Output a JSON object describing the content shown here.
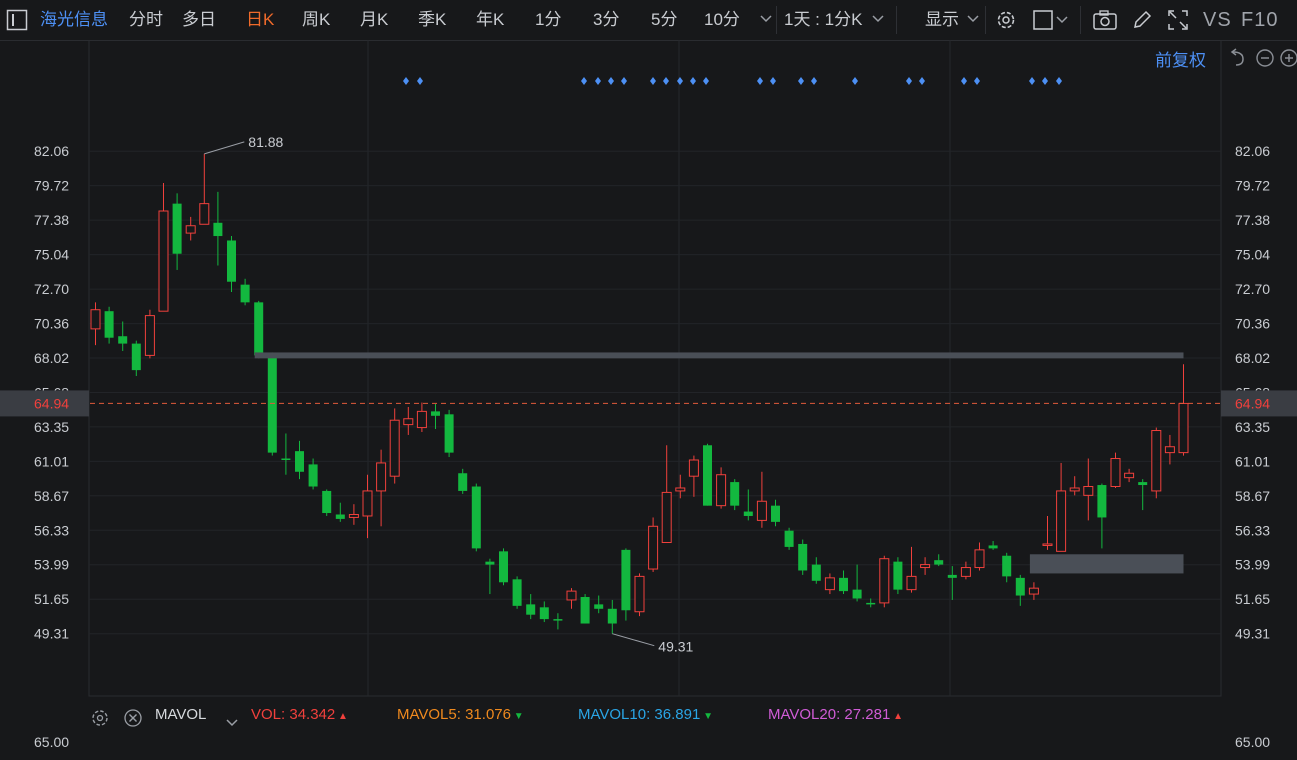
{
  "toolbar": {
    "stock_name": "海光信息",
    "periods": [
      "分时",
      "多日",
      "日K",
      "周K",
      "月K",
      "季K",
      "年K",
      "1分",
      "3分",
      "5分",
      "10分"
    ],
    "active_period": "日K",
    "combo": "1天 : 1分K",
    "display": "显示",
    "vs": "VS",
    "f10": "F10",
    "adjust": "前复权"
  },
  "chart_data": {
    "type": "candlestick",
    "y_ticks": [
      "82.06",
      "79.72",
      "77.38",
      "75.04",
      "72.70",
      "70.36",
      "68.02",
      "65.68",
      "63.35",
      "61.01",
      "58.67",
      "56.33",
      "53.99",
      "51.65",
      "49.31"
    ],
    "ylim": [
      47.66,
      84.72
    ],
    "current_price": "64.94",
    "max_label": "81.88",
    "min_label": "49.31",
    "up_color": "#f0403c",
    "down_color": "#13b83f",
    "candles": [
      {
        "o": 70.0,
        "h": 71.8,
        "l": 68.9,
        "c": 71.3
      },
      {
        "o": 71.2,
        "h": 71.5,
        "l": 69.0,
        "c": 69.4
      },
      {
        "o": 69.5,
        "h": 70.5,
        "l": 68.5,
        "c": 69.0
      },
      {
        "o": 69.0,
        "h": 69.2,
        "l": 66.8,
        "c": 67.2
      },
      {
        "o": 68.2,
        "h": 71.3,
        "l": 68.0,
        "c": 70.9
      },
      {
        "o": 71.2,
        "h": 79.9,
        "l": 71.2,
        "c": 78.0
      },
      {
        "o": 78.5,
        "h": 79.2,
        "l": 74.0,
        "c": 75.1
      },
      {
        "o": 76.5,
        "h": 77.6,
        "l": 76.0,
        "c": 77.0
      },
      {
        "o": 77.1,
        "h": 81.88,
        "l": 77.1,
        "c": 78.5
      },
      {
        "o": 77.2,
        "h": 79.3,
        "l": 74.3,
        "c": 76.3
      },
      {
        "o": 76.0,
        "h": 76.3,
        "l": 72.5,
        "c": 73.2
      },
      {
        "o": 73.0,
        "h": 73.4,
        "l": 71.6,
        "c": 71.8
      },
      {
        "o": 71.8,
        "h": 71.9,
        "l": 68.0,
        "c": 68.2
      },
      {
        "o": 68.2,
        "h": 68.4,
        "l": 61.4,
        "c": 61.6
      },
      {
        "o": 61.2,
        "h": 62.9,
        "l": 60.1,
        "c": 61.1
      },
      {
        "o": 61.7,
        "h": 62.4,
        "l": 59.8,
        "c": 60.3
      },
      {
        "o": 60.8,
        "h": 61.2,
        "l": 59.1,
        "c": 59.3
      },
      {
        "o": 59.0,
        "h": 59.1,
        "l": 57.3,
        "c": 57.5
      },
      {
        "o": 57.4,
        "h": 58.2,
        "l": 56.9,
        "c": 57.1
      },
      {
        "o": 57.2,
        "h": 58.1,
        "l": 56.7,
        "c": 57.4
      },
      {
        "o": 57.3,
        "h": 60.1,
        "l": 55.8,
        "c": 59.0
      },
      {
        "o": 59.0,
        "h": 61.8,
        "l": 56.6,
        "c": 60.9
      },
      {
        "o": 60.0,
        "h": 64.6,
        "l": 59.5,
        "c": 63.8
      },
      {
        "o": 63.5,
        "h": 64.7,
        "l": 62.8,
        "c": 63.9
      },
      {
        "o": 63.3,
        "h": 65.0,
        "l": 63.0,
        "c": 64.4
      },
      {
        "o": 64.4,
        "h": 64.9,
        "l": 63.2,
        "c": 64.1
      },
      {
        "o": 64.2,
        "h": 64.5,
        "l": 61.3,
        "c": 61.6
      },
      {
        "o": 60.2,
        "h": 60.5,
        "l": 58.8,
        "c": 59.0
      },
      {
        "o": 59.3,
        "h": 59.5,
        "l": 54.9,
        "c": 55.1
      },
      {
        "o": 54.2,
        "h": 54.4,
        "l": 52.0,
        "c": 54.0
      },
      {
        "o": 54.9,
        "h": 55.1,
        "l": 52.6,
        "c": 52.8
      },
      {
        "o": 53.0,
        "h": 53.2,
        "l": 51.0,
        "c": 51.2
      },
      {
        "o": 51.3,
        "h": 52.0,
        "l": 50.3,
        "c": 50.6
      },
      {
        "o": 51.1,
        "h": 51.5,
        "l": 50.1,
        "c": 50.3
      },
      {
        "o": 50.3,
        "h": 50.7,
        "l": 49.6,
        "c": 50.2
      },
      {
        "o": 51.6,
        "h": 52.4,
        "l": 51.0,
        "c": 52.2
      },
      {
        "o": 51.8,
        "h": 52.0,
        "l": 50.0,
        "c": 50.0
      },
      {
        "o": 51.3,
        "h": 51.9,
        "l": 50.7,
        "c": 51.0
      },
      {
        "o": 51.0,
        "h": 51.6,
        "l": 49.31,
        "c": 50.0
      },
      {
        "o": 55.0,
        "h": 55.1,
        "l": 50.2,
        "c": 50.9
      },
      {
        "o": 50.8,
        "h": 53.4,
        "l": 50.5,
        "c": 53.2
      },
      {
        "o": 53.7,
        "h": 57.2,
        "l": 53.5,
        "c": 56.6
      },
      {
        "o": 55.5,
        "h": 62.1,
        "l": 55.5,
        "c": 58.9
      },
      {
        "o": 59.0,
        "h": 60.1,
        "l": 58.5,
        "c": 59.2
      },
      {
        "o": 60.0,
        "h": 61.4,
        "l": 58.6,
        "c": 61.1
      },
      {
        "o": 62.1,
        "h": 62.2,
        "l": 58.0,
        "c": 58.0
      },
      {
        "o": 58.0,
        "h": 60.6,
        "l": 57.8,
        "c": 60.1
      },
      {
        "o": 59.6,
        "h": 59.8,
        "l": 57.7,
        "c": 58.0
      },
      {
        "o": 57.6,
        "h": 59.1,
        "l": 57.0,
        "c": 57.3
      },
      {
        "o": 57.0,
        "h": 60.3,
        "l": 56.5,
        "c": 58.3
      },
      {
        "o": 58.0,
        "h": 58.4,
        "l": 56.6,
        "c": 56.9
      },
      {
        "o": 56.3,
        "h": 56.5,
        "l": 55.0,
        "c": 55.2
      },
      {
        "o": 55.4,
        "h": 55.7,
        "l": 53.3,
        "c": 53.6
      },
      {
        "o": 54.0,
        "h": 54.5,
        "l": 52.7,
        "c": 52.9
      },
      {
        "o": 52.3,
        "h": 53.4,
        "l": 52.0,
        "c": 53.1
      },
      {
        "o": 53.1,
        "h": 53.6,
        "l": 52.0,
        "c": 52.2
      },
      {
        "o": 52.3,
        "h": 54.0,
        "l": 51.5,
        "c": 51.7
      },
      {
        "o": 51.4,
        "h": 51.7,
        "l": 51.1,
        "c": 51.3
      },
      {
        "o": 51.4,
        "h": 54.6,
        "l": 51.1,
        "c": 54.4
      },
      {
        "o": 54.2,
        "h": 54.5,
        "l": 52.0,
        "c": 52.3
      },
      {
        "o": 52.3,
        "h": 55.2,
        "l": 52.1,
        "c": 53.2
      },
      {
        "o": 53.8,
        "h": 54.5,
        "l": 53.3,
        "c": 54.0
      },
      {
        "o": 54.3,
        "h": 54.7,
        "l": 53.9,
        "c": 54.0
      },
      {
        "o": 53.3,
        "h": 53.9,
        "l": 51.6,
        "c": 53.1
      },
      {
        "o": 53.2,
        "h": 54.2,
        "l": 53.0,
        "c": 53.8
      },
      {
        "o": 53.8,
        "h": 55.5,
        "l": 53.6,
        "c": 55.0
      },
      {
        "o": 55.3,
        "h": 55.6,
        "l": 55.0,
        "c": 55.1
      },
      {
        "o": 54.6,
        "h": 54.8,
        "l": 52.8,
        "c": 53.2
      },
      {
        "o": 53.1,
        "h": 53.3,
        "l": 51.2,
        "c": 51.9
      },
      {
        "o": 52.0,
        "h": 52.8,
        "l": 51.6,
        "c": 52.4
      },
      {
        "o": 55.3,
        "h": 57.3,
        "l": 55.0,
        "c": 55.4
      },
      {
        "o": 54.9,
        "h": 60.9,
        "l": 54.9,
        "c": 59.0
      },
      {
        "o": 59.0,
        "h": 60.0,
        "l": 58.7,
        "c": 59.2
      },
      {
        "o": 58.7,
        "h": 61.2,
        "l": 57.0,
        "c": 59.3
      },
      {
        "o": 59.4,
        "h": 59.5,
        "l": 55.1,
        "c": 57.2
      },
      {
        "o": 59.3,
        "h": 61.6,
        "l": 59.2,
        "c": 61.2
      },
      {
        "o": 59.9,
        "h": 60.5,
        "l": 59.6,
        "c": 60.2
      },
      {
        "o": 59.6,
        "h": 59.8,
        "l": 57.7,
        "c": 59.4
      },
      {
        "o": 59.0,
        "h": 63.3,
        "l": 58.5,
        "c": 63.1
      },
      {
        "o": 61.6,
        "h": 62.8,
        "l": 60.8,
        "c": 62.0
      },
      {
        "o": 61.6,
        "h": 67.6,
        "l": 61.4,
        "c": 64.94
      }
    ],
    "resistance_band": [
      68.0,
      68.4
    ],
    "support_band": [
      53.4,
      54.7
    ],
    "event_markers": [
      12,
      13,
      19,
      20,
      21,
      22,
      24,
      25,
      26,
      27,
      28,
      31,
      32,
      34,
      35,
      37,
      39,
      40,
      43,
      44,
      49,
      50,
      51
    ],
    "indicator": "MAVOL",
    "vol": [
      {
        "label": "VOL:",
        "value": "34.342",
        "color": "#f0403c",
        "dir": "up"
      },
      {
        "label": "MAVOL5:",
        "value": "31.076",
        "color": "#f08a1e",
        "dir": "down"
      },
      {
        "label": "MAVOL10:",
        "value": "36.891",
        "color": "#2aa5e6",
        "dir": "down"
      },
      {
        "label": "MAVOL20:",
        "value": "27.281",
        "color": "#d05cd6",
        "dir": "up"
      }
    ],
    "sub_next_tick": "65.00"
  }
}
